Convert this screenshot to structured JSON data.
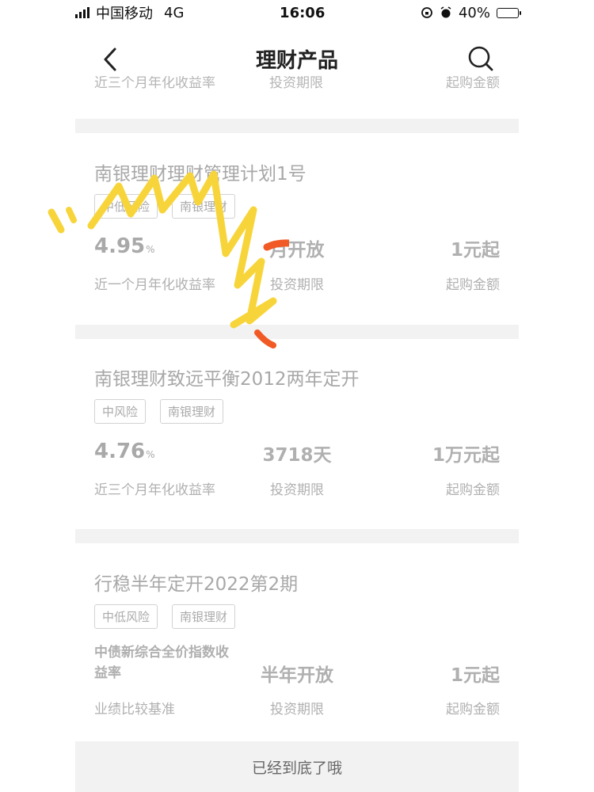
{
  "status_bar": {
    "carrier": "中国移动",
    "network": "4G",
    "time": "16:06",
    "battery": "40%",
    "battery_level": 0.4
  },
  "nav": {
    "title": "理财产品",
    "back_icon": "chevron-left-icon",
    "search_icon": "search-icon"
  },
  "partial_row": {
    "rate_label": "近三个月年化收益率",
    "period_label": "投资期限",
    "amount_label": "起购金额"
  },
  "products": [
    {
      "name": "南银理财理财管理计划1号",
      "tags": [
        "中低风险",
        "南银理财"
      ],
      "rate": "4.95",
      "rate_unit": "%",
      "rate_label": "近一个月年化收益率",
      "period": "月开放",
      "period_label": "投资期限",
      "amount": "1元起",
      "amount_label": "起购金额"
    },
    {
      "name": "南银理财致远平衡2012两年定开",
      "tags": [
        "中风险",
        "南银理财"
      ],
      "rate": "4.76",
      "rate_unit": "%",
      "rate_label": "近三个月年化收益率",
      "period": "3718天",
      "period_label": "投资期限",
      "amount": "1万元起",
      "amount_label": "起购金额"
    },
    {
      "name": "行稳半年定开2022第2期",
      "tags": [
        "中低风险",
        "南银理财"
      ],
      "benchmark": "中债新综合全价指数收益率",
      "benchmark_label": "业绩比较基准",
      "period": "半年开放",
      "period_label": "投资期限",
      "amount": "1元起",
      "amount_label": "起购金额"
    }
  ],
  "footer": {
    "text": "已经到底了哦"
  },
  "colors": {
    "divider": "#f2f2f2",
    "muted_text": "#b0b0b0",
    "scribble_yellow": "#f7d53a",
    "scribble_orange": "#f15a24"
  }
}
